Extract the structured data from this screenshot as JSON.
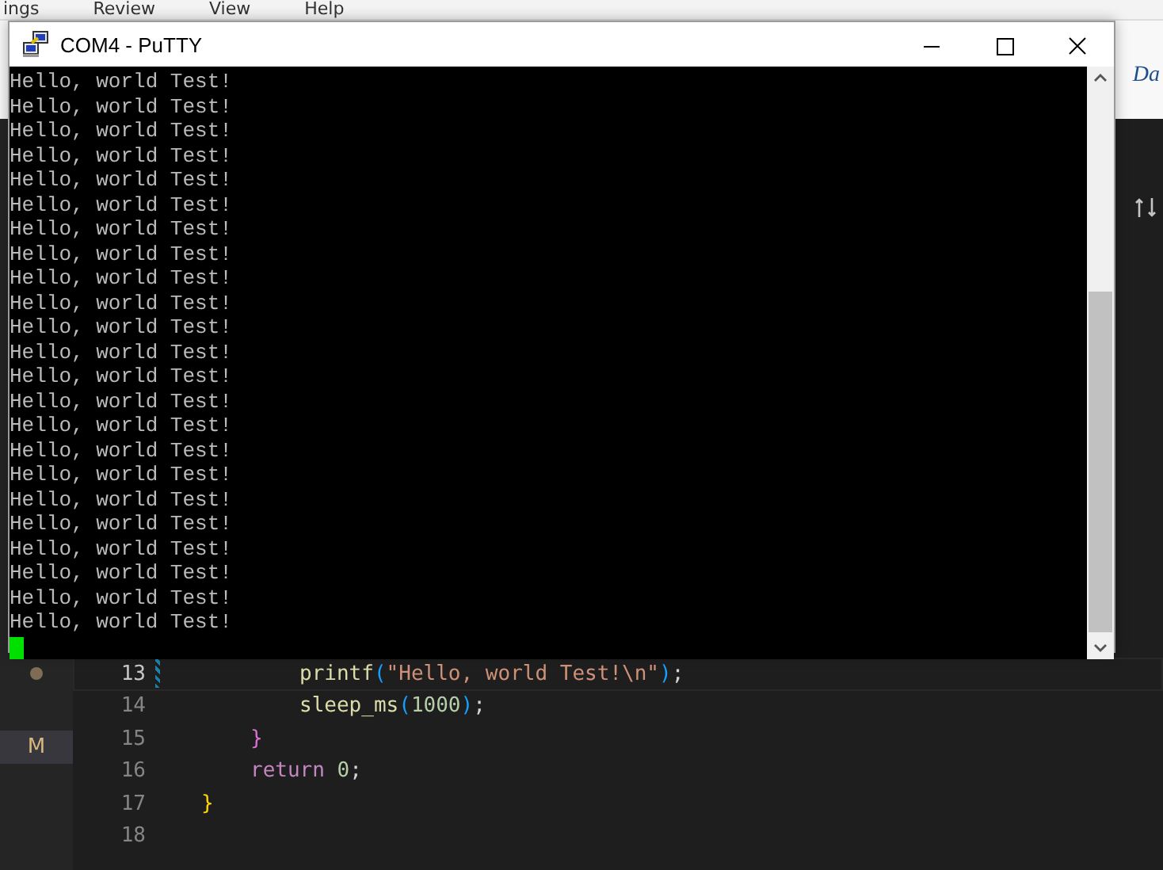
{
  "background_menu": [
    "ings",
    "Review",
    "View",
    "Help"
  ],
  "ribbon_text": "Da",
  "window": {
    "title": "COM4 - PuTTY",
    "terminal_lines": [
      "Hello, world Test!",
      "Hello, world Test!",
      "Hello, world Test!",
      "Hello, world Test!",
      "Hello, world Test!",
      "Hello, world Test!",
      "Hello, world Test!",
      "Hello, world Test!",
      "Hello, world Test!",
      "Hello, world Test!",
      "Hello, world Test!",
      "Hello, world Test!",
      "Hello, world Test!",
      "Hello, world Test!",
      "Hello, world Test!",
      "Hello, world Test!",
      "Hello, world Test!",
      "Hello, world Test!",
      "Hello, world Test!",
      "Hello, world Test!",
      "Hello, world Test!",
      "Hello, world Test!",
      "Hello, world Test!"
    ]
  },
  "editor": {
    "gutter_badge": "M",
    "lines": [
      {
        "children": [
          {
            "children": [
              {
                "number": "13",
                "current": true,
                "tokens": [
                  {
                    "kind": "function",
                    "text": "printf"
                  },
                  {
                    "kind": "paren",
                    "text": "("
                  },
                  {
                    "kind": "string",
                    "text": "\"Hello, world Test!\\n\""
                  },
                  {
                    "kind": "paren",
                    "text": ")"
                  },
                  {
                    "kind": "plain",
                    "text": ";"
                  }
                ]
              },
              {
                "number": "14",
                "current": false,
                "tokens": [
                  {
                    "kind": "function",
                    "text": "sleep_ms"
                  },
                  {
                    "kind": "paren",
                    "text": "("
                  },
                  {
                    "kind": "number",
                    "text": "1000"
                  },
                  {
                    "kind": "paren",
                    "text": ")"
                  },
                  {
                    "kind": "plain",
                    "text": ";"
                  }
                ]
              }
            ]
          },
          {
            "number": "15",
            "current": false,
            "tokens": [
              {
                "kind": "brace2",
                "text": "}"
              }
            ]
          },
          {
            "number": "16",
            "current": false,
            "tokens": [
              {
                "kind": "keyword",
                "text": "return"
              },
              {
                "kind": "number",
                "text": "0"
              },
              {
                "kind": "plain",
                "text": ";"
              }
            ]
          }
        ]
      },
      {
        "number": "17",
        "current": false,
        "tokens": [
          {
            "kind": "brace1",
            "text": "}"
          }
        ]
      },
      {
        "number": "18",
        "current": false
      }
    ]
  }
}
